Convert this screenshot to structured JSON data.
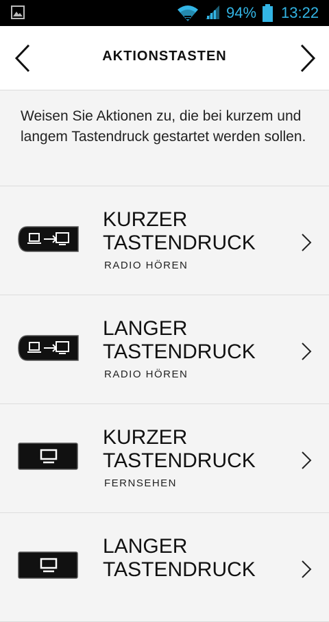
{
  "status_bar": {
    "battery_percent": "94%",
    "time": "13:22",
    "icons": [
      "image-icon",
      "wifi-icon",
      "signal-icon",
      "battery-icon"
    ],
    "accent_color": "#33b5e5"
  },
  "header": {
    "title": "AKTIONSTASTEN",
    "back_icon": "chevron-left-icon",
    "next_icon": "chevron-right-icon"
  },
  "intro": {
    "text": "Weisen Sie Aktionen zu, die bei kurzem und langem Tastendruck gestartet werden sollen."
  },
  "actions": [
    {
      "line1": "KURZER",
      "line2": "TASTENDRUCK",
      "subtitle": "RADIO HÖREN",
      "key_icon": "source-switch-key-icon"
    },
    {
      "line1": "LANGER",
      "line2": "TASTENDRUCK",
      "subtitle": "RADIO HÖREN",
      "key_icon": "source-switch-key-icon"
    },
    {
      "line1": "KURZER",
      "line2": "TASTENDRUCK",
      "subtitle": "FERNSEHEN",
      "key_icon": "tv-key-icon"
    },
    {
      "line1": "LANGER",
      "line2": "TASTENDRUCK",
      "subtitle": "",
      "key_icon": "tv-key-icon"
    }
  ]
}
